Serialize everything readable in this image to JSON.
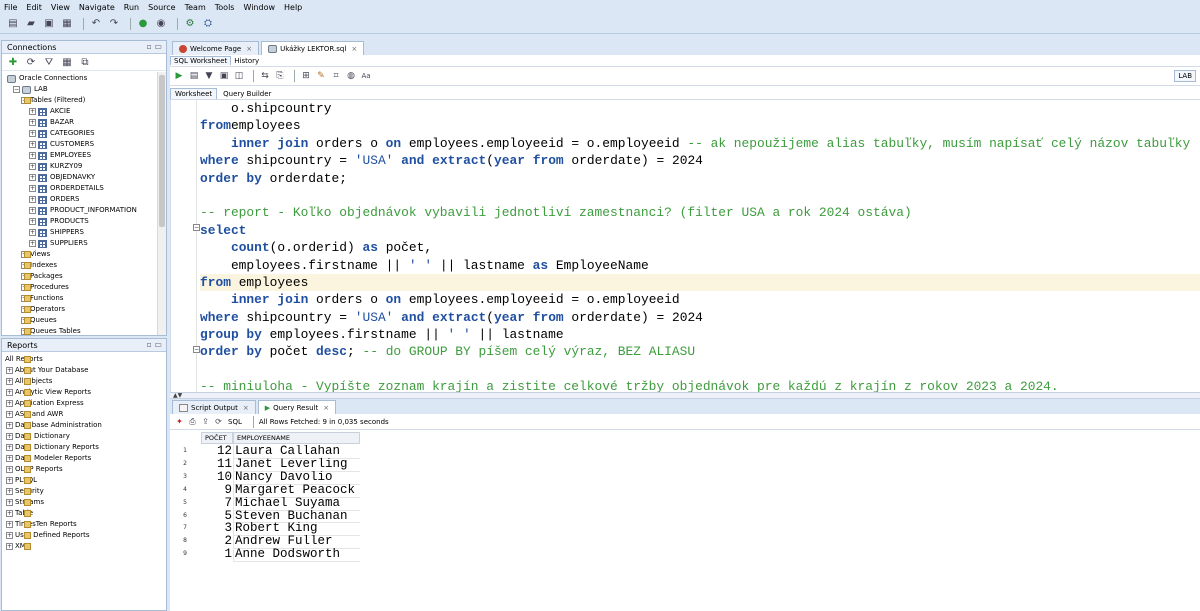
{
  "menu": [
    "File",
    "Edit",
    "View",
    "Navigate",
    "Run",
    "Source",
    "Team",
    "Tools",
    "Window",
    "Help"
  ],
  "connections": {
    "title": "Connections",
    "items": [
      {
        "label": "Oracle Connections",
        "level": 0,
        "type": "db",
        "expander": ""
      },
      {
        "label": "LAB",
        "level": 1,
        "type": "db",
        "expander": "−"
      },
      {
        "label": "Tables (Filtered)",
        "level": 2,
        "type": "fold",
        "expander": "−"
      },
      {
        "label": "AKCIE",
        "level": 3,
        "type": "tbl",
        "expander": "+"
      },
      {
        "label": "BAZAR",
        "level": 3,
        "type": "tbl",
        "expander": "+"
      },
      {
        "label": "CATEGORIES",
        "level": 3,
        "type": "tbl",
        "expander": "+"
      },
      {
        "label": "CUSTOMERS",
        "level": 3,
        "type": "tbl",
        "expander": "+"
      },
      {
        "label": "EMPLOYEES",
        "level": 3,
        "type": "tbl",
        "expander": "+"
      },
      {
        "label": "KURZY09",
        "level": 3,
        "type": "tbl",
        "expander": "+"
      },
      {
        "label": "OBJEDNAVKY",
        "level": 3,
        "type": "tbl",
        "expander": "+"
      },
      {
        "label": "ORDERDETAILS",
        "level": 3,
        "type": "tbl",
        "expander": "+"
      },
      {
        "label": "ORDERS",
        "level": 3,
        "type": "tbl",
        "expander": "+"
      },
      {
        "label": "PRODUCT_INFORMATION",
        "level": 3,
        "type": "tbl",
        "expander": "+"
      },
      {
        "label": "PRODUCTS",
        "level": 3,
        "type": "tbl",
        "expander": "+"
      },
      {
        "label": "SHIPPERS",
        "level": 3,
        "type": "tbl",
        "expander": "+"
      },
      {
        "label": "SUPPLIERS",
        "level": 3,
        "type": "tbl",
        "expander": "+"
      },
      {
        "label": "Views",
        "level": 2,
        "type": "fold",
        "expander": "+"
      },
      {
        "label": "Indexes",
        "level": 2,
        "type": "fold",
        "expander": "+"
      },
      {
        "label": "Packages",
        "level": 2,
        "type": "fold",
        "expander": "+"
      },
      {
        "label": "Procedures",
        "level": 2,
        "type": "fold",
        "expander": "+"
      },
      {
        "label": "Functions",
        "level": 2,
        "type": "fold",
        "expander": "+"
      },
      {
        "label": "Operators",
        "level": 2,
        "type": "fold",
        "expander": "+"
      },
      {
        "label": "Queues",
        "level": 2,
        "type": "fold",
        "expander": "+"
      },
      {
        "label": "Queues Tables",
        "level": 2,
        "type": "fold",
        "expander": "+"
      }
    ]
  },
  "reports": {
    "title": "Reports",
    "items": [
      {
        "label": "All Reports",
        "level": 0,
        "expander": ""
      },
      {
        "label": "About Your Database",
        "level": 1,
        "expander": "+"
      },
      {
        "label": "All Objects",
        "level": 1,
        "expander": "+"
      },
      {
        "label": "Analytic View Reports",
        "level": 1,
        "expander": "+"
      },
      {
        "label": "Application Express",
        "level": 1,
        "expander": "+"
      },
      {
        "label": "ASH and AWR",
        "level": 1,
        "expander": "+"
      },
      {
        "label": "Database Administration",
        "level": 1,
        "expander": "+"
      },
      {
        "label": "Data Dictionary",
        "level": 1,
        "expander": "+"
      },
      {
        "label": "Data Dictionary Reports",
        "level": 1,
        "expander": "+"
      },
      {
        "label": "Data Modeler Reports",
        "level": 1,
        "expander": "+"
      },
      {
        "label": "OLAP Reports",
        "level": 1,
        "expander": "+"
      },
      {
        "label": "PLSQL",
        "level": 1,
        "expander": "+"
      },
      {
        "label": "Security",
        "level": 1,
        "expander": "+"
      },
      {
        "label": "Streams",
        "level": 1,
        "expander": "+"
      },
      {
        "label": "Table",
        "level": 1,
        "expander": "+"
      },
      {
        "label": "TimesTen Reports",
        "level": 1,
        "expander": "+"
      },
      {
        "label": "User Defined Reports",
        "level": 1,
        "expander": "+"
      },
      {
        "label": "XML",
        "level": 1,
        "expander": "+"
      }
    ]
  },
  "editor_tabs": {
    "welcome": "Welcome Page",
    "file": "Ukážky LEKTOR.sql"
  },
  "sub_tabs": {
    "worksheet": "SQL Worksheet",
    "history": "History"
  },
  "ws_tabs": {
    "worksheet": "Worksheet",
    "query_builder": "Query Builder"
  },
  "connection_label": "LAB",
  "code_lines": [
    [
      [
        "",
        "    o.shipcountry"
      ]
    ],
    [
      [
        "kw",
        "from"
      ],
      [
        "",
        "employees"
      ]
    ],
    [
      [
        "",
        "    "
      ],
      [
        "kw",
        "inner join"
      ],
      [
        "",
        " orders o "
      ],
      [
        "kw",
        "on"
      ],
      [
        "",
        " employees.employeeid = o.employeeid "
      ],
      [
        "cm",
        "-- ak nepoužijeme alias tabuľky, musím napísať celý názov tabuľky"
      ]
    ],
    [
      [
        "kw",
        "where"
      ],
      [
        "",
        " shipcountry = "
      ],
      [
        "st",
        "'USA'"
      ],
      [
        "",
        " "
      ],
      [
        "kw",
        "and"
      ],
      [
        "",
        " "
      ],
      [
        "kw",
        "extract"
      ],
      [
        "",
        "("
      ],
      [
        "kw",
        "year from"
      ],
      [
        "",
        " orderdate) = 2024"
      ]
    ],
    [
      [
        "kw",
        "order by"
      ],
      [
        "",
        " orderdate;"
      ]
    ],
    [
      [
        "",
        ""
      ]
    ],
    [
      [
        "cm",
        "-- report - Koľko objednávok vybavili jednotliví zamestnanci? (filter USA a rok 2024 ostáva)"
      ]
    ],
    [
      [
        "kw",
        "select"
      ]
    ],
    [
      [
        "",
        "    "
      ],
      [
        "kw",
        "count"
      ],
      [
        "",
        "(o.orderid) "
      ],
      [
        "kw",
        "as"
      ],
      [
        "",
        " počet,"
      ]
    ],
    [
      [
        "",
        "    employees.firstname || "
      ],
      [
        "st",
        "' '"
      ],
      [
        "",
        " || lastname "
      ],
      [
        "kw",
        "as"
      ],
      [
        "",
        " EmployeeName"
      ]
    ],
    [
      [
        "kw",
        "from"
      ],
      [
        "",
        " employees"
      ]
    ],
    [
      [
        "",
        "    "
      ],
      [
        "kw",
        "inner join"
      ],
      [
        "",
        " orders o "
      ],
      [
        "kw",
        "on"
      ],
      [
        "",
        " employees.employeeid = o.employeeid"
      ]
    ],
    [
      [
        "kw",
        "where"
      ],
      [
        "",
        " shipcountry = "
      ],
      [
        "st",
        "'USA'"
      ],
      [
        "",
        " "
      ],
      [
        "kw",
        "and"
      ],
      [
        "",
        " "
      ],
      [
        "kw",
        "extract"
      ],
      [
        "",
        "("
      ],
      [
        "kw",
        "year from"
      ],
      [
        "",
        " orderdate) = 2024"
      ]
    ],
    [
      [
        "kw",
        "group by"
      ],
      [
        "",
        " employees.firstname || "
      ],
      [
        "st",
        "' '"
      ],
      [
        "",
        " || lastname"
      ]
    ],
    [
      [
        "kw",
        "order by"
      ],
      [
        "",
        " počet "
      ],
      [
        "kw",
        "desc"
      ],
      [
        "",
        "; "
      ],
      [
        "cm",
        "-- do GROUP BY píšem celý výraz, BEZ ALIASU"
      ]
    ],
    [
      [
        "",
        ""
      ]
    ],
    [
      [
        "cm",
        "-- miniuloha - Vypíšte zoznam krajín a zistite celkové tržby objednávok pre každú z krajín z rokov 2023 a 2024."
      ]
    ]
  ],
  "output_tabs": {
    "script_output": "Script Output",
    "query_result": "Query Result"
  },
  "output_toolbar": {
    "sql_label": "SQL",
    "status": "All Rows Fetched: 9 in 0,035 seconds"
  },
  "results": {
    "columns": [
      "POČET",
      "EMPLOYEENAME"
    ],
    "rows": [
      {
        "n": "1",
        "count": "12",
        "name": "Laura Callahan"
      },
      {
        "n": "2",
        "count": "11",
        "name": "Janet Leverling"
      },
      {
        "n": "3",
        "count": "10",
        "name": "Nancy Davolio"
      },
      {
        "n": "4",
        "count": "9",
        "name": "Margaret Peacock"
      },
      {
        "n": "5",
        "count": "7",
        "name": "Michael Suyama"
      },
      {
        "n": "6",
        "count": "5",
        "name": "Steven Buchanan"
      },
      {
        "n": "7",
        "count": "3",
        "name": "Robert King"
      },
      {
        "n": "8",
        "count": "2",
        "name": "Andrew Fuller"
      },
      {
        "n": "9",
        "count": "1",
        "name": "Anne Dodsworth"
      }
    ]
  }
}
